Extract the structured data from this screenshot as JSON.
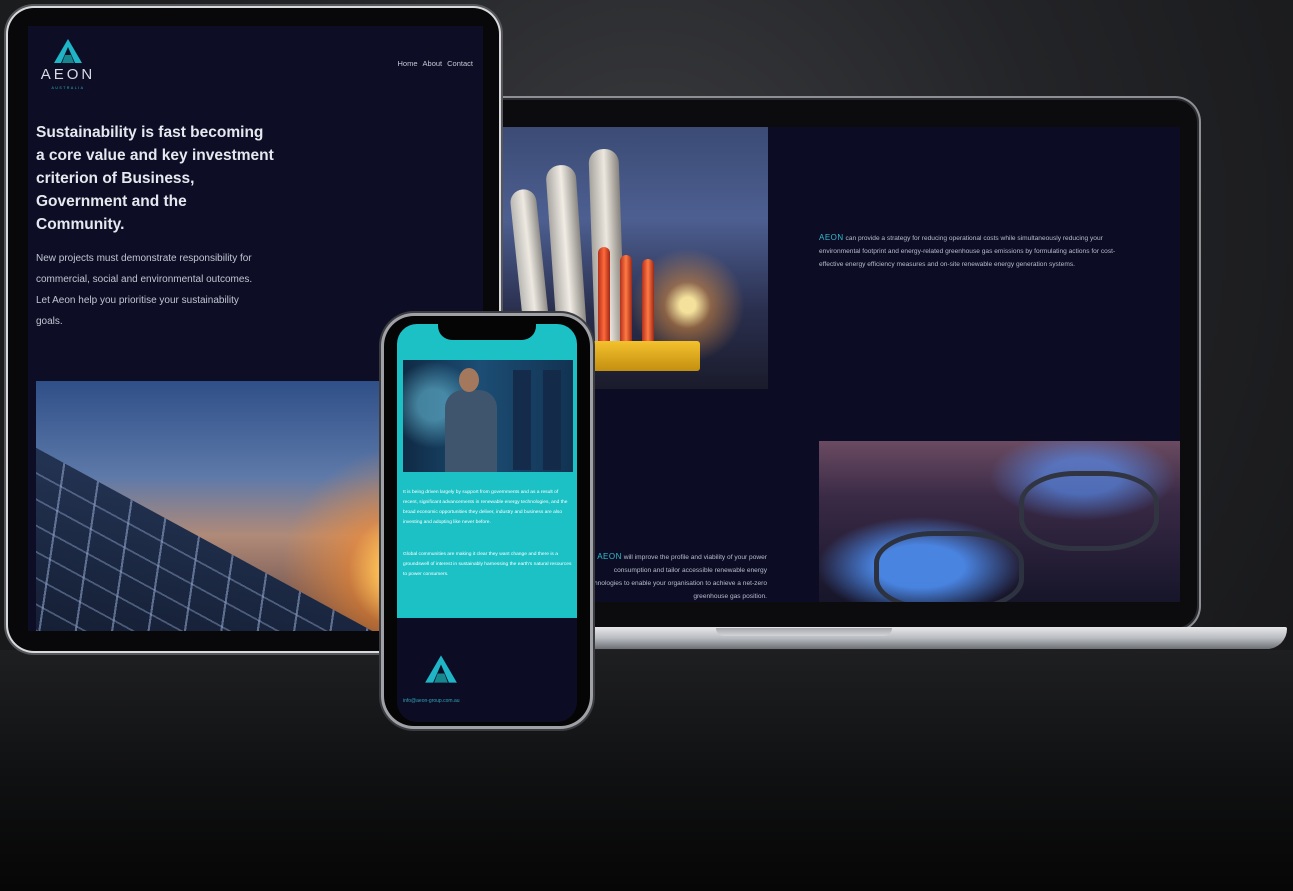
{
  "colors": {
    "navy_background": "#0c0d24",
    "teal_accent": "#1cc1c6",
    "brand_text": "#33bcd0"
  },
  "icons": [
    "aeon-logo-icon"
  ],
  "tablet": {
    "brand": "AEON",
    "brand_sub": "AUSTRALIA",
    "nav": [
      "Home",
      "About",
      "Contact"
    ],
    "headline": "Sustainability is fast becoming a core value and key investment criterion of Business, Government and the Community.",
    "body": "New projects must demonstrate responsibility for commercial, social and environmental outcomes. Let Aeon help you prioritise your sustainability goals."
  },
  "laptop": {
    "paragraph1_brand": "AEON",
    "paragraph1_text": "can provide a strategy for reducing operational costs while simultaneously reducing your environmental footprint and energy-related greenhouse gas emissions by formulating actions for cost-effective energy efficiency measures and on-site renewable energy generation systems.",
    "paragraph2_brand": "AEON",
    "paragraph2_text": "will improve the profile and viability of your power consumption and tailor accessible renewable energy technologies to enable your organisation to achieve a net-zero greenhouse gas position."
  },
  "phone": {
    "paragraph1": "It is being driven largely by support from governments and as a result of recent, significant advancements in renewable energy technologies, and the broad economic opportunities they deliver, industry and business are also investing and adopting like never before.",
    "paragraph2": "Global communities are making it clear they want change and there is a groundswell of interest in sustainably harnessing the earth's natural resources to power consumers.",
    "email": "info@aeon-group.com.au"
  }
}
